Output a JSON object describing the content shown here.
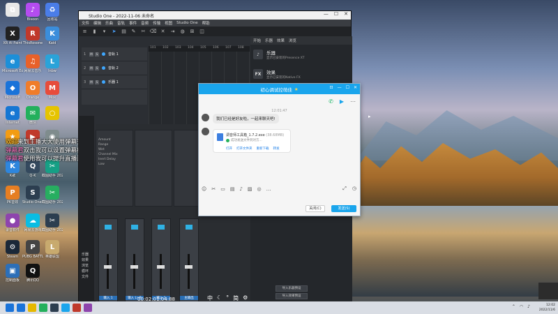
{
  "desktop_icons": [
    {
      "label": "",
      "color": "#e8e8e8",
      "glyph": "⧉"
    },
    {
      "label": "Bisoon",
      "color": "#b44cf0",
      "glyph": "♪"
    },
    {
      "label": "回收站",
      "color": "#4a7de8",
      "glyph": "♻"
    },
    {
      "label": "XR AI Paint",
      "color": "#222222",
      "glyph": "X"
    },
    {
      "label": "ThisRosone",
      "color": "#c0392b",
      "glyph": "R"
    },
    {
      "label": "Kaid",
      "color": "#3b8ddb",
      "glyph": "K"
    },
    {
      "label": "Microsoft Edge",
      "color": "#1d8fd8",
      "glyph": "e"
    },
    {
      "label": "网易云音乐",
      "color": "#e8612a",
      "glyph": "♫"
    },
    {
      "label": "lnbw",
      "color": "#2aa3d9",
      "glyph": "L"
    },
    {
      "label": "Microsoft",
      "color": "#1a73d9",
      "glyph": "◆"
    },
    {
      "label": "Orange",
      "color": "#f07c2a",
      "glyph": "O"
    },
    {
      "label": "Mox",
      "color": "#e74c3c",
      "glyph": "M"
    },
    {
      "label": "Internet",
      "color": "#1676d3",
      "glyph": "e"
    },
    {
      "label": "微信",
      "color": "#23b05c",
      "glyph": "✉"
    },
    {
      "label": "",
      "color": "#e6c400",
      "glyph": "○"
    },
    {
      "label": "",
      "color": "#f39c12",
      "glyph": "★"
    },
    {
      "label": "",
      "color": "#c0392b",
      "glyph": "▶"
    },
    {
      "label": "",
      "color": "#7f8c8d",
      "glyph": "◉"
    },
    {
      "label": "K歌",
      "color": "#2e86de",
      "glyph": "K"
    },
    {
      "label": "Q-K",
      "color": "#34495e",
      "glyph": "Q"
    },
    {
      "label": "截图助手 20221...",
      "color": "#16a085",
      "glyph": "✂"
    },
    {
      "label": "PK音效",
      "color": "#e67e22",
      "glyph": "P"
    },
    {
      "label": "Studio One 5",
      "color": "#2c3e50",
      "glyph": "S"
    },
    {
      "label": "截图助手 20221...",
      "color": "#27ae60",
      "glyph": "✂"
    },
    {
      "label": "录音软件",
      "color": "#8e44ad",
      "glyph": "●"
    },
    {
      "label": "网易云游戏",
      "color": "#0abde3",
      "glyph": "☁"
    },
    {
      "label": "截图助手 20221...",
      "color": "#2c3e50",
      "glyph": "✂"
    },
    {
      "label": "Steam",
      "color": "#1b2838",
      "glyph": "⚙"
    },
    {
      "label": "PUBG BATTLEGR...",
      "color": "#444444",
      "glyph": "P"
    },
    {
      "label": "英雄联盟",
      "color": "#c8aa6e",
      "glyph": "L"
    },
    {
      "label": "控制面板",
      "color": "#2d6fb8",
      "glyph": "▣"
    },
    {
      "label": "腾讯QQ",
      "color": "#111111",
      "glyph": "Q"
    }
  ],
  "chat_overlay": [
    {
      "name": "欢迎",
      "text": "来到主播大大使用弹幕秀~"
    },
    {
      "name": "弹幕君",
      "text": "双击我可以设置弹幕样式，筛选展示哦~"
    },
    {
      "name": "弹幕君",
      "text": "使用我可以提升直播间趣味哦(#^0^#)"
    }
  ],
  "studio_one": {
    "title": "Studio One - 2022-11-06 未命名",
    "menu": [
      "文件",
      "编辑",
      "乐曲",
      "音轨",
      "事件",
      "音频",
      "传输",
      "视图",
      "Studio One",
      "帮助"
    ],
    "right_top": [
      "开始",
      "乐器",
      "效果",
      "浏览"
    ],
    "tracks": [
      {
        "num": "1",
        "name": "音轨 1"
      },
      {
        "num": "2",
        "name": "音轨 2"
      },
      {
        "num": "3",
        "name": "乐器 1"
      }
    ],
    "ruler": [
      "101",
      "102",
      "103",
      "104",
      "105",
      "106",
      "107",
      "108"
    ],
    "browser": [
      {
        "icon": "♪",
        "title": "乐器",
        "sub": "显示已安装的Presence XT"
      },
      {
        "icon": "FX",
        "title": "效果",
        "sub": "显示已安装的Native FX"
      }
    ],
    "browser_buttons": [
      "导入乐器预设",
      "导入效果预设"
    ],
    "sends": [
      "Amount",
      "Range",
      "Wet",
      "Channel Mix",
      "Inert Delay",
      "Low"
    ],
    "inspector_items": [
      "乐器",
      "效果",
      "浏览",
      "循环",
      "文件"
    ],
    "strips": [
      {
        "label": "输入 1"
      },
      {
        "label": "输入 L+R"
      },
      {
        "label": "输入 1"
      },
      {
        "label": "主输出"
      }
    ],
    "bottom_time": "00:02:01:04:88",
    "ime_chars": [
      "中",
      "简"
    ]
  },
  "qq": {
    "title": "初心调试控萌佳",
    "timestamp": "12:01:47",
    "message": "我们已经是好友啦，一起来聊天吧!",
    "file_name": "调音师工具箱_1.7.2.exe",
    "file_size": "(38.68MB)",
    "file_status": "成功发送文件到对方...",
    "file_links": [
      "打开",
      "打开文件夹",
      "重新下载",
      "转发"
    ],
    "toolbar_icons": [
      "☺",
      "✂",
      "▭",
      "▤",
      "♪",
      "▨",
      "◎",
      "…"
    ],
    "close_label": "关闭(C)",
    "send_label": "发送(S)"
  },
  "taskbar": {
    "time": "12:02",
    "date": "2022/11/6",
    "app_colors": [
      "#1a73d9",
      "#e6b800",
      "#23b05c",
      "#2c3e50",
      "#1aa5ec",
      "#c0392b",
      "#8e44ad"
    ]
  }
}
